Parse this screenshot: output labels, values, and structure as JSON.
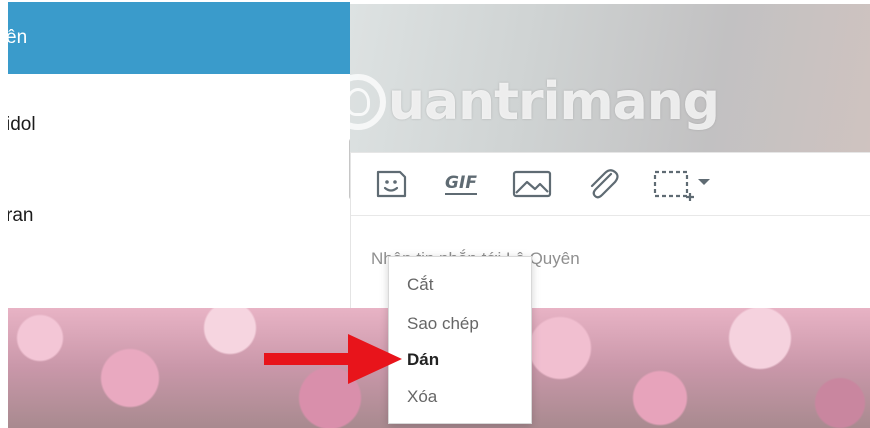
{
  "contacts": [
    {
      "name": "ên",
      "selected": true
    },
    {
      "name": "idol",
      "selected": false
    },
    {
      "name": "ran",
      "selected": false
    }
  ],
  "watermark": {
    "text": "uantrimang"
  },
  "toolbar": {
    "gif_label": "GIF",
    "icons": [
      "sticker-icon",
      "gif-icon",
      "image-icon",
      "attachment-icon",
      "screen-capture-icon"
    ]
  },
  "composer": {
    "placeholder": "Nhập tin nhắn tới Lệ Quyên"
  },
  "context_menu": {
    "items": [
      "Cắt",
      "Sao chép",
      "Dán",
      "Xóa"
    ],
    "highlighted": "Dán"
  },
  "colors": {
    "selected_contact": "#3a9bcb",
    "arrow": "#e8141b"
  }
}
